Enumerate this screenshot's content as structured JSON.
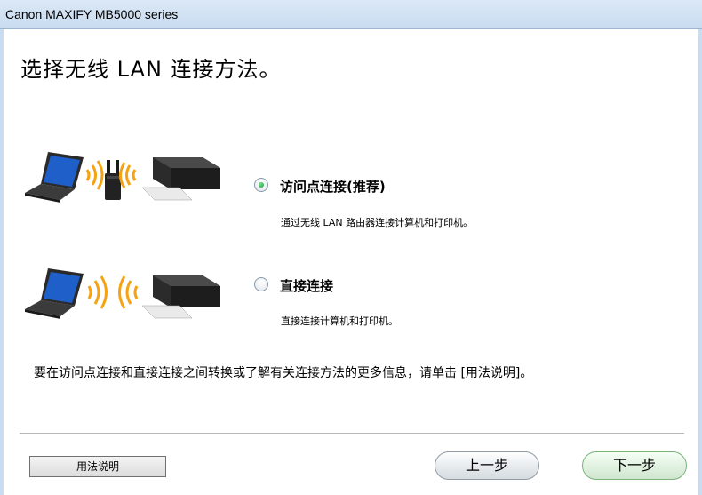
{
  "window": {
    "title": "Canon MAXIFY MB5000 series"
  },
  "heading": "选择无线 LAN 连接方法。",
  "options": [
    {
      "label": "访问点连接(推荐)",
      "description": "通过无线 LAN 路由器连接计算机和打印机。",
      "selected": true
    },
    {
      "label": "直接连接",
      "description": "直接连接计算机和打印机。",
      "selected": false
    }
  ],
  "info_text": "要在访问点连接和直接连接之间转换或了解有关连接方法的更多信息，请单击 [用法说明]。",
  "buttons": {
    "help": "用法说明",
    "back": "上一步",
    "next": "下一步"
  },
  "colors": {
    "radio_selected": "#1f9a3e",
    "titlebar": "#c9dcf0",
    "wifi_waves": "#f5a312",
    "laptop_screen": "#1e5fc9"
  },
  "icons": [
    "laptop-icon",
    "router-icon",
    "wifi-waves-icon",
    "printer-icon"
  ]
}
